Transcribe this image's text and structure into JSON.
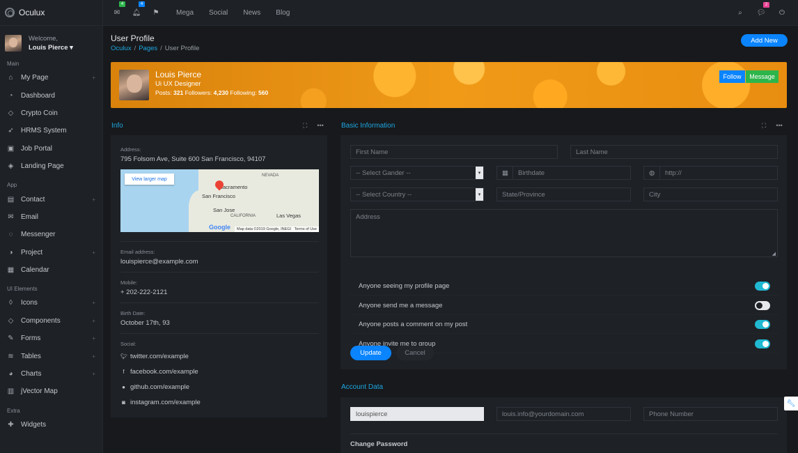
{
  "brand": {
    "name": "Oculux"
  },
  "user": {
    "welcome": "Welcome,",
    "name": "Louis Pierce"
  },
  "sidebar": {
    "sections": [
      {
        "title": "Main",
        "items": [
          {
            "label": "My Page",
            "icon": "home-icon",
            "plus": true
          },
          {
            "label": "Dashboard",
            "icon": "speedometer-icon",
            "plus": false
          },
          {
            "label": "Crypto Coin",
            "icon": "diamond-icon",
            "plus": false
          },
          {
            "label": "HRMS System",
            "icon": "rocket-icon",
            "plus": false
          },
          {
            "label": "Job Portal",
            "icon": "briefcase-icon",
            "plus": false
          },
          {
            "label": "Landing Page",
            "icon": "drop-icon",
            "plus": false
          }
        ]
      },
      {
        "title": "App",
        "items": [
          {
            "label": "Contact",
            "icon": "contacts-icon",
            "plus": true
          },
          {
            "label": "Email",
            "icon": "envelope-icon",
            "plus": false
          },
          {
            "label": "Messenger",
            "icon": "bubbles-icon",
            "plus": false
          },
          {
            "label": "Project",
            "icon": "project-icon",
            "plus": true
          },
          {
            "label": "Calendar",
            "icon": "calendar-icon",
            "plus": false
          }
        ]
      },
      {
        "title": "UI Elements",
        "items": [
          {
            "label": "Icons",
            "icon": "tag-icon",
            "plus": true
          },
          {
            "label": "Components",
            "icon": "diamond-icon",
            "plus": true
          },
          {
            "label": "Forms",
            "icon": "pencil-icon",
            "plus": true
          },
          {
            "label": "Tables",
            "icon": "layers-icon",
            "plus": true
          },
          {
            "label": "Charts",
            "icon": "pie-chart-icon",
            "plus": true
          },
          {
            "label": "jVector Map",
            "icon": "map-icon",
            "plus": false
          }
        ]
      },
      {
        "title": "Extra",
        "items": [
          {
            "label": "Widgets",
            "icon": "puzzle-icon",
            "plus": false
          }
        ]
      }
    ]
  },
  "topbar": {
    "mail_badge": "4",
    "bell_badge": "4",
    "links": [
      "Mega",
      "Social",
      "News",
      "Blog"
    ],
    "chat_badge": "2",
    "colors": {
      "mail_badge": "#2db54b",
      "bell_badge": "#0a84ff",
      "chat_badge": "#e84393"
    }
  },
  "page": {
    "title": "User Profile",
    "crumbs": [
      "Oculux",
      "Pages",
      "User Profile"
    ],
    "add_new": "Add New"
  },
  "banner": {
    "name": "Louis Pierce",
    "role": "Ui UX Designer",
    "posts_label": "Posts:",
    "posts": "321",
    "followers_label": "Followers:",
    "followers": "4,230",
    "following_label": "Following:",
    "following": "560",
    "follow": "Follow",
    "message": "Message"
  },
  "info": {
    "title": "Info",
    "address_label": "Address:",
    "address": "795 Folsom Ave, Suite 600 San Francisco, 94107",
    "map": {
      "button": "View larger map",
      "labels": [
        "NEVADA",
        "Sacramento",
        "San Francisco",
        "San Jose",
        "CALIFORNIA",
        "Las Vegas"
      ],
      "google": "Google",
      "footer_data": "Map data ©2019 Google, INEGI",
      "footer_terms": "Terms of Use"
    },
    "email_label": "Email address:",
    "email": "louispierce@example.com",
    "mobile_label": "Mobile:",
    "mobile": "+ 202-222-2121",
    "birth_label": "Birth Date:",
    "birth": "October 17th, 93",
    "social_label": "Social:",
    "social": [
      {
        "icon": "twitter-icon",
        "text": "twitter.com/example"
      },
      {
        "icon": "facebook-icon",
        "text": "facebook.com/example"
      },
      {
        "icon": "github-icon",
        "text": "github.com/example"
      },
      {
        "icon": "instagram-icon",
        "text": "instagram.com/example"
      }
    ]
  },
  "basic": {
    "title": "Basic Information",
    "first_name": "First Name",
    "last_name": "Last Name",
    "gender": "-- Select Gander --",
    "birthdate": "Birthdate",
    "website": "http://",
    "country": "-- Select Country --",
    "state": "State/Province",
    "city": "City",
    "address": "Address",
    "toggles": [
      {
        "label": "Anyone seeing my profile page",
        "on": true
      },
      {
        "label": "Anyone send me a message",
        "on": false
      },
      {
        "label": "Anyone posts a comment on my post",
        "on": true
      },
      {
        "label": "Anyone invite me to group",
        "on": true
      }
    ],
    "update": "Update",
    "cancel": "Cancel"
  },
  "account": {
    "title": "Account Data",
    "username": "louispierce",
    "email": "louis.info@yourdomain.com",
    "phone": "Phone Number",
    "change_password": "Change Password"
  }
}
